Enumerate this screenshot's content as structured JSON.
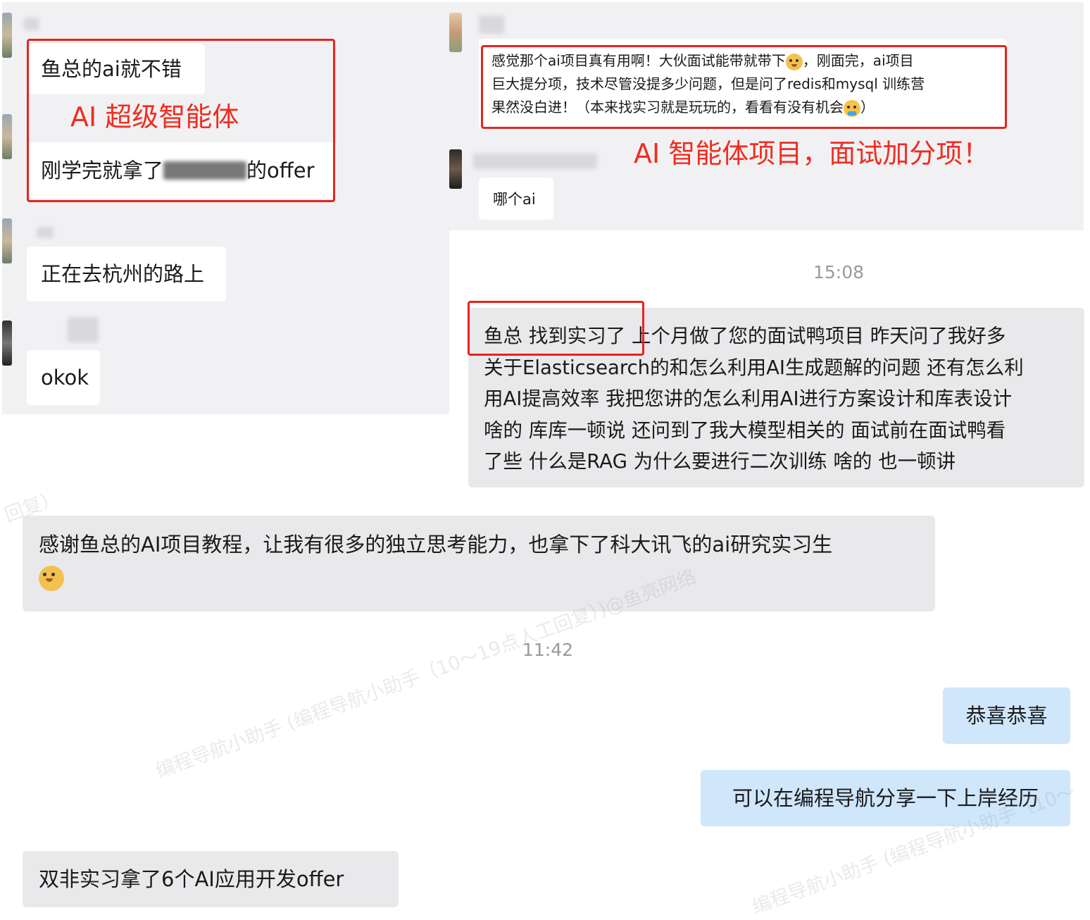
{
  "screenshot1": {
    "msg1": "鱼总的ai就不错",
    "annotation": "AI 超级智能体",
    "msg2_prefix": "刚学完就拿了",
    "msg2_suffix": "的offer",
    "msg3": "正在去杭州的路上",
    "msg4": "okok"
  },
  "screenshot2": {
    "msg1_line1": "感觉那个ai项目真有用啊！大伙面试能带就带下",
    "msg1_line1_tail": "，刚面完，ai项目",
    "msg1_line2": "巨大提分项，技术尽管没提多少问题，但是问了redis和mysql 训练营",
    "msg1_line3": "果然没白进！（本来找实习就是玩玩的，看看有没有机会",
    "msg1_line3_tail": "）",
    "annotation": "AI 智能体项目，面试加分项！",
    "msg2": "哪个ai"
  },
  "screenshot3": {
    "time": "15:08",
    "highlight": "鱼总 找到实习了",
    "line1_rest": "上个月做了您的面试鸭项目 昨天问了我好多",
    "line2": "关于Elasticsearch的和怎么利用AI生成题解的问题 还有怎么利",
    "line3": "用AI提高效率 我把您讲的怎么利用AI进行方案设计和库表设计",
    "line4": "啥的 库库一顿说 还问到了我大模型相关的 面试前在面试鸭看",
    "line5": "了些 什么是RAG 为什么要进行二次训练 啥的 也一顿讲"
  },
  "screenshot4": {
    "msg": "感谢鱼总的AI项目教程，让我有很多的独立思考能力，也拿下了科大讯飞的ai研究实习生",
    "time": "11:42",
    "reply1": "恭喜恭喜",
    "reply2": "可以在编程导航分享一下上岸经历",
    "msg_last": "双非实习拿了6个AI应用开发offer"
  },
  "watermarks": {
    "wm1": "编程导航小助手 (编程导航小助手（10～19点人工回复）)@鱼亮网络",
    "wm2": "编程导航小助手 (编程导航小助手（10～",
    "wm3": "回复）"
  },
  "icons": [
    "avatar-landscape",
    "avatar-cartoon",
    "avatar-dark",
    "emoji-doge",
    "emoji-crying"
  ],
  "colors": {
    "annotation_red": "#ef2d21",
    "reply_blue": "#cfe6fb",
    "panel_gray": "#f1f1f3",
    "bubble_gray": "#e9e9eb"
  }
}
